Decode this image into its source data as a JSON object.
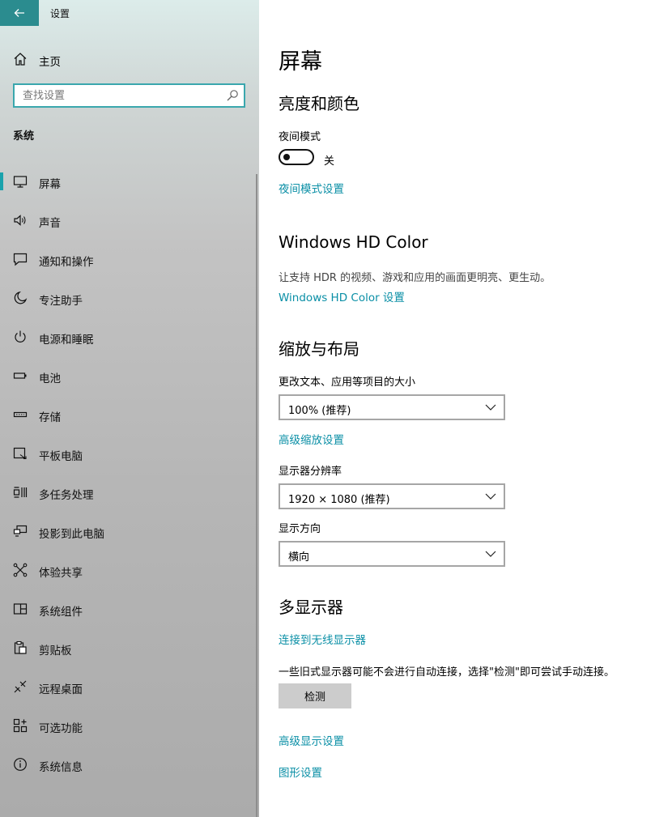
{
  "window": {
    "title": "设置"
  },
  "sidebar": {
    "home_label": "主页",
    "search_placeholder": "查找设置",
    "section_label": "系统",
    "items": [
      {
        "label": "屏幕",
        "icon": "monitor-icon",
        "active": true
      },
      {
        "label": "声音",
        "icon": "speaker-icon"
      },
      {
        "label": "通知和操作",
        "icon": "message-icon"
      },
      {
        "label": "专注助手",
        "icon": "moon-icon"
      },
      {
        "label": "电源和睡眠",
        "icon": "power-icon"
      },
      {
        "label": "电池",
        "icon": "battery-icon"
      },
      {
        "label": "存储",
        "icon": "storage-icon"
      },
      {
        "label": "平板电脑",
        "icon": "tablet-icon"
      },
      {
        "label": "多任务处理",
        "icon": "multitask-icon"
      },
      {
        "label": "投影到此电脑",
        "icon": "project-icon"
      },
      {
        "label": "体验共享",
        "icon": "share-icon"
      },
      {
        "label": "系统组件",
        "icon": "components-icon"
      },
      {
        "label": "剪贴板",
        "icon": "clipboard-icon"
      },
      {
        "label": "远程桌面",
        "icon": "remote-icon"
      },
      {
        "label": "可选功能",
        "icon": "features-icon"
      },
      {
        "label": "系统信息",
        "icon": "info-icon"
      }
    ]
  },
  "main": {
    "title": "屏幕",
    "brightness": {
      "heading": "亮度和颜色",
      "night_light_label": "夜间模式",
      "night_light_state": "关",
      "night_light_link": "夜间模式设置"
    },
    "hdr": {
      "heading": "Windows HD Color",
      "description": "让支持 HDR 的视频、游戏和应用的画面更明亮、更生动。",
      "link": "Windows HD Color 设置"
    },
    "scale": {
      "heading": "缩放与布局",
      "size_label": "更改文本、应用等项目的大小",
      "size_value": "100% (推荐)",
      "advanced_link": "高级缩放设置",
      "resolution_label": "显示器分辨率",
      "resolution_value": "1920 × 1080 (推荐)",
      "orientation_label": "显示方向",
      "orientation_value": "横向"
    },
    "multi": {
      "heading": "多显示器",
      "wireless_link": "连接到无线显示器",
      "description": "一些旧式显示器可能不会进行自动连接，选择\"检测\"即可尝试手动连接。",
      "detect_button": "检测",
      "advanced_display_link": "高级显示设置",
      "graphics_link": "图形设置"
    }
  },
  "colors": {
    "accent": "#0a8fa6",
    "back_button": "#2b8c8f",
    "selection_indicator": "#1aa2ac"
  }
}
